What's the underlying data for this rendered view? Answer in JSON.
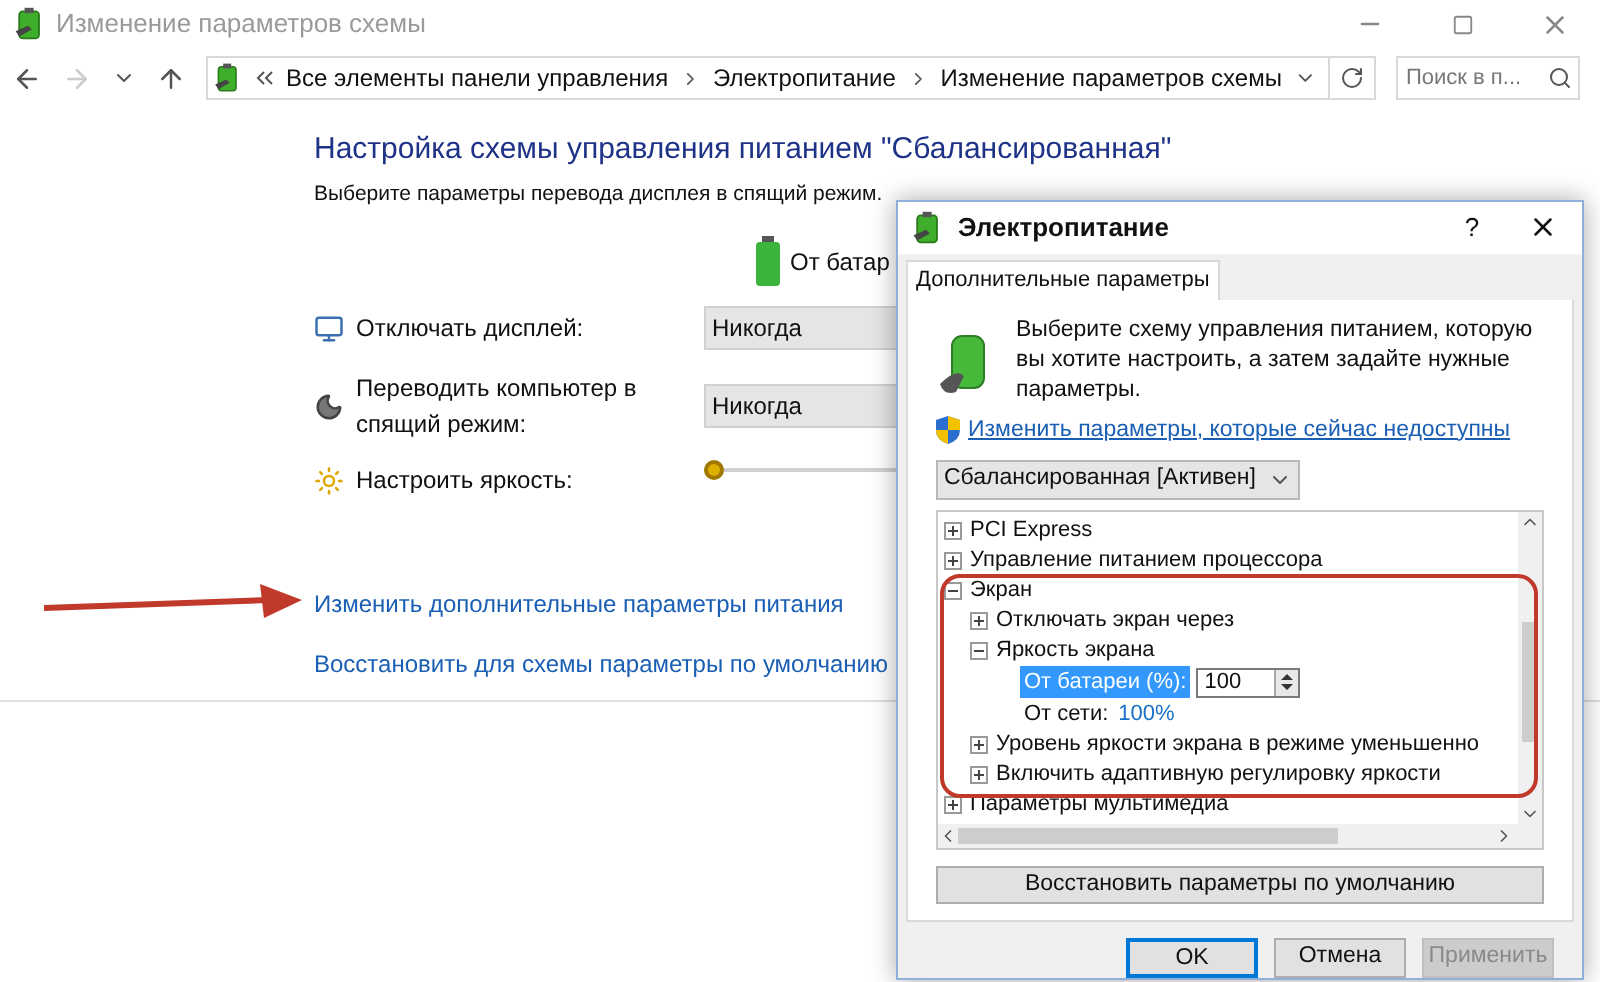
{
  "window": {
    "title": "Изменение параметров схемы"
  },
  "address_bar": {
    "breadcrumbs": [
      "Все элементы панели управления",
      "Электропитание",
      "Изменение параметров схемы"
    ],
    "search": {
      "placeholder": "Поиск в п..."
    }
  },
  "plan": {
    "heading": "Настройка схемы управления питанием \"Сбалансированная\"",
    "subtitle": "Выберите параметры перевода дисплея в спящий режим.",
    "column_header": "От батар",
    "settings": [
      {
        "kind": "dropdown",
        "label": "Отключать дисплей:",
        "value": "Никогда"
      },
      {
        "kind": "dropdown",
        "label": "Переводить компьютер в спящий режим:",
        "value": "Никогда"
      },
      {
        "kind": "slider",
        "label": "Настроить яркость:",
        "level": 0
      }
    ],
    "links": [
      "Изменить дополнительные параметры питания",
      "Восстановить для схемы параметры по умолчанию"
    ]
  },
  "dialog": {
    "title": "Электропитание",
    "help": "?",
    "tabs": [
      {
        "label": "Дополнительные параметры",
        "selected": true
      }
    ],
    "description": "Выберите схему управления питанием, которую вы хотите настроить, а затем задайте нужные параметры.",
    "link": "Изменить параметры, которые сейчас недоступны",
    "plan_select": {
      "value": "Сбалансированная [Активен]"
    },
    "tree": [
      {
        "kind": "group",
        "label": "PCI Express",
        "expanded": false
      },
      {
        "kind": "group",
        "label": "Управление питанием процессора",
        "expanded": false
      },
      {
        "kind": "group",
        "label": "Экран",
        "expanded": true,
        "children": [
          {
            "kind": "group",
            "label": "Отключать экран через",
            "expanded": false
          },
          {
            "kind": "group",
            "label": "Яркость экрана",
            "expanded": true,
            "children": [
              {
                "kind": "spinner",
                "label": "От батареи (%):",
                "value": "100",
                "selected": true
              },
              {
                "kind": "value",
                "label": "От сети:",
                "value": "100%",
                "selected": false
              }
            ]
          },
          {
            "kind": "group",
            "label": "Уровень яркости экрана в режиме уменьшенно",
            "expanded": false
          },
          {
            "kind": "group",
            "label": "Включить адаптивную регулировку яркости",
            "expanded": false
          }
        ]
      },
      {
        "kind": "group",
        "label": "Параметры мультимедиа",
        "expanded": false
      }
    ],
    "restore_button": "Восстановить параметры по умолчанию",
    "buttons": [
      {
        "label": "OK",
        "default": true,
        "disabled": false
      },
      {
        "label": "Отмена",
        "default": false,
        "disabled": false
      },
      {
        "label": "Применить",
        "default": false,
        "disabled": true
      }
    ]
  }
}
